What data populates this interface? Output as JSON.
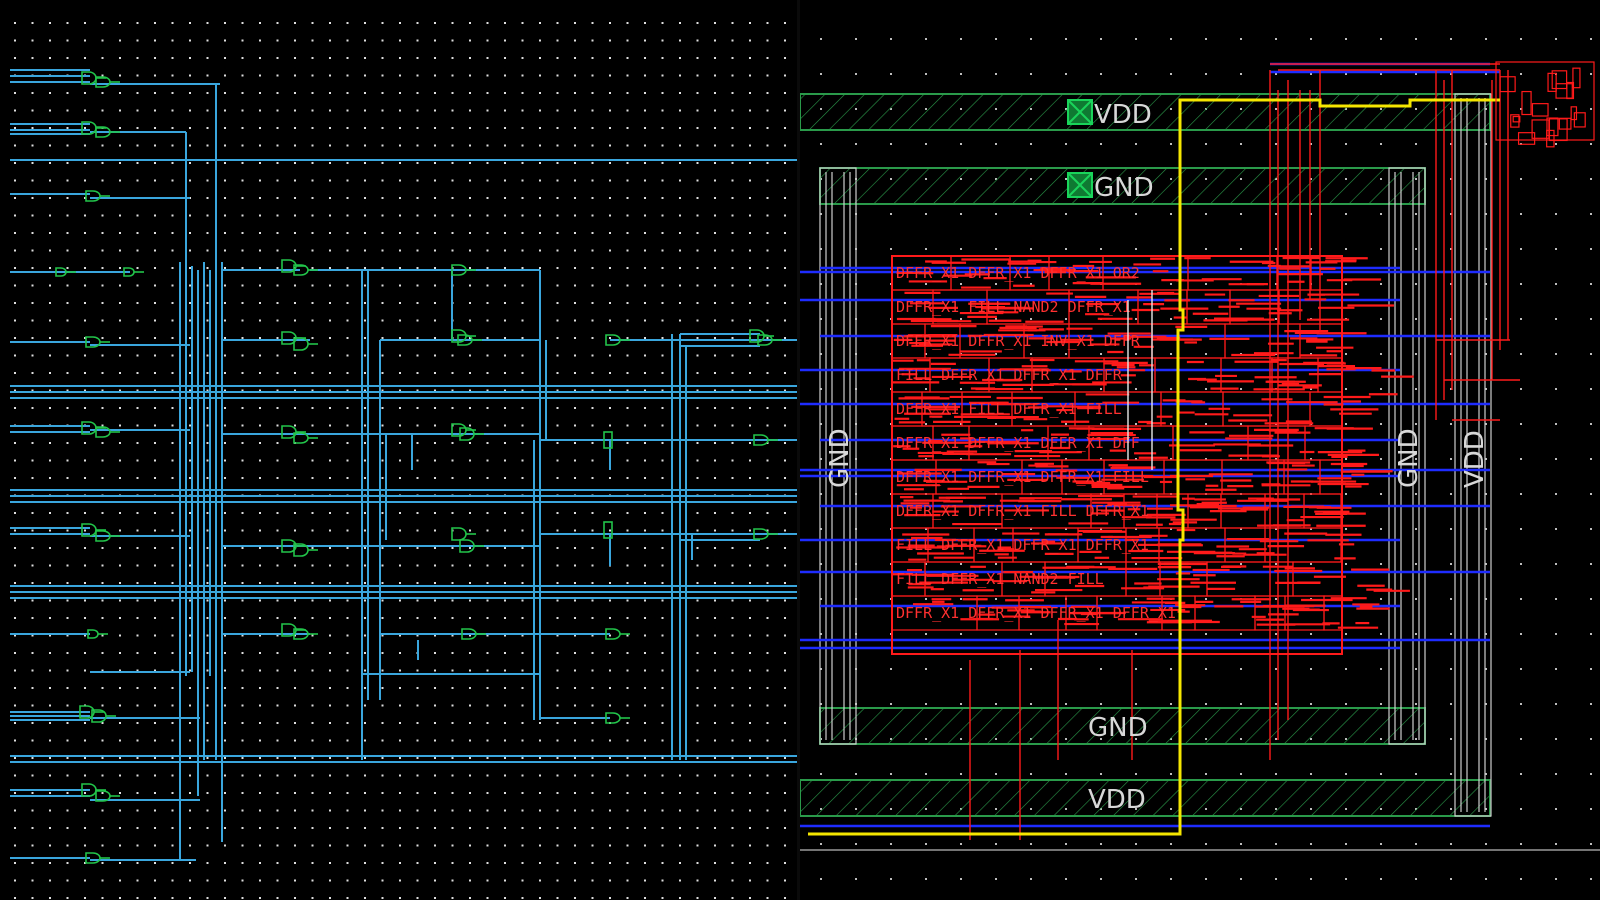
{
  "schematic": {
    "wire_color": "#3aa6dd",
    "gate_color": "#22c44a",
    "background": "#000000",
    "grid_dot_color": "#e0e0e0"
  },
  "layout": {
    "colors": {
      "metal_red": "#ff1a1a",
      "metal_blue": "#1e2cff",
      "power_green": "#2a9a4a",
      "clock_yellow": "#f5e600",
      "outline_white": "#cfcfcf",
      "contact_green": "#19d45a"
    },
    "rails": {
      "vdd_top": "VDD",
      "gnd_top": "GND",
      "gnd_bottom": "GND",
      "vdd_bottom": "VDD",
      "gnd_left": "GND",
      "gnd_right": "GND",
      "vdd_right": "VDD"
    },
    "cell_rows": [
      "DFFR_X1 DFFR_X1 DFFR_X1 OR2",
      "DFFR_X1 FILL NAND2 DFFR_X1",
      "DFFR_X1 DFFR_X1 INV_X1 DFFR",
      "FILL DFFR_X1 DFFR_X1 DFFR",
      "DFFR_X1 FILL DFFR_X1 FILL",
      "DFFR_X1 DFFR_X1 DFFR_X1 DFF",
      "DFFR_X1 DFFR_X1 DFFR_X1 FILL",
      "DFFR_X1 DFFR_X1 FILL DFFR_X1",
      "FILL DFFR_X1 DFFR_X1 DFFR_X1",
      "FILL DFFR_X1 NAND2 FILL",
      "DFFR_X1 DFFR_X1 DFFR_X1 DFFR_X1"
    ]
  }
}
